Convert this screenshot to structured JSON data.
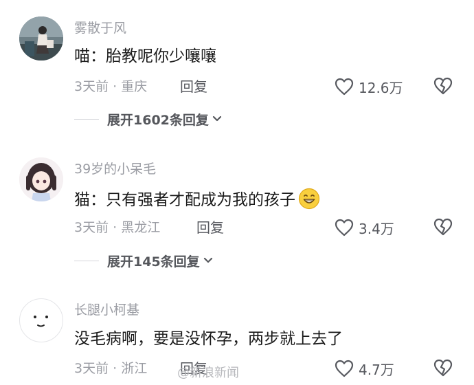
{
  "comments": [
    {
      "username": "雾散于风",
      "text": "喵：胎教呢你少嚷嚷",
      "time_location": "3天前 · 重庆",
      "reply_label": "回复",
      "likes": "12.6万",
      "expand_label": "展开1602条回复",
      "avatar_icon": "girl-photo-avatar"
    },
    {
      "username": "39岁的小呆毛",
      "text": "猫：只有强者才配成为我的孩子",
      "emoji": "grin-emoji",
      "time_location": "3天前 · 黑龙江",
      "reply_label": "回复",
      "likes": "3.4万",
      "expand_label": "展开145条回复",
      "avatar_icon": "anime-girl-avatar"
    },
    {
      "username": "长腿小柯基",
      "text": "没毛病啊，要是没怀孕，两步就上去了",
      "time_location": "3天前 · 浙江",
      "reply_label": "回复",
      "likes": "4.7万",
      "avatar_icon": "smiley-face-avatar"
    }
  ],
  "watermark": "@新浪新闻",
  "colors": {
    "text_primary": "#1a1a1a",
    "text_secondary": "#9a9ca3",
    "text_action": "#57595f"
  }
}
